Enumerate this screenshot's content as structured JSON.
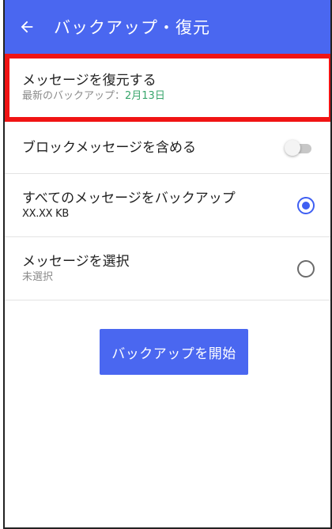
{
  "appbar": {
    "title": "バックアップ・復元",
    "back_icon": "arrow-back-icon"
  },
  "restore": {
    "title": "メッセージを復元する",
    "subtitle_label": "最新のバックアップ：",
    "subtitle_date": "2月13日"
  },
  "block": {
    "label": "ブロックメッセージを含める",
    "toggle_on": false
  },
  "backup_all": {
    "label": "すべてのメッセージをバックアップ",
    "size": "XX.XX KB",
    "selected": true
  },
  "select": {
    "label": "メッセージを選択",
    "subtitle": "未選択",
    "selected": false
  },
  "start_button": {
    "label": "バックアップを開始"
  },
  "colors": {
    "appbar": "#4a67f0",
    "accent_date": "#37a56b",
    "radio_selected": "#3f5ff2",
    "highlight": "#f01414"
  }
}
